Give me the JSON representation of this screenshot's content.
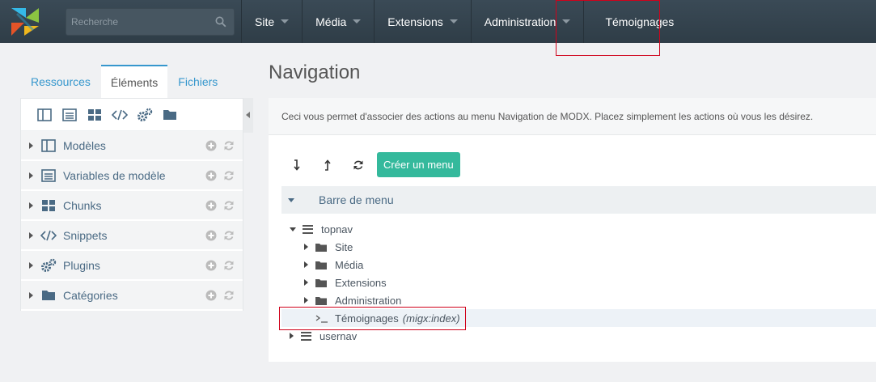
{
  "header": {
    "search_placeholder": "Recherche",
    "menu": [
      {
        "label": "Site"
      },
      {
        "label": "Média"
      },
      {
        "label": "Extensions"
      },
      {
        "label": "Administration"
      },
      {
        "label": "Témoignages"
      }
    ]
  },
  "sidebar": {
    "tabs": [
      {
        "label": "Ressources"
      },
      {
        "label": "Éléments",
        "active": true
      },
      {
        "label": "Fichiers"
      }
    ],
    "toolbar_icons": [
      "template-icon",
      "tv-icon",
      "chunk-icon",
      "snippet-icon",
      "plugin-icon",
      "folder-icon"
    ],
    "items": [
      {
        "label": "Modèles",
        "icon": "template-icon"
      },
      {
        "label": "Variables de modèle",
        "icon": "tv-icon"
      },
      {
        "label": "Chunks",
        "icon": "chunk-icon"
      },
      {
        "label": "Snippets",
        "icon": "snippet-icon"
      },
      {
        "label": "Plugins",
        "icon": "plugin-icon"
      },
      {
        "label": "Catégories",
        "icon": "folder-icon"
      }
    ]
  },
  "main": {
    "title": "Navigation",
    "description": "Ceci vous permet d'associer des actions au menu Navigation de MODX. Placez simplement les actions où vous les désirez.",
    "actions": {
      "create_label": "Créer un menu"
    },
    "tree": {
      "header_label": "Barre de menu",
      "topnav": "topnav",
      "children": [
        "Site",
        "Média",
        "Extensions",
        "Administration"
      ],
      "custom_item": "Témoignages",
      "custom_item_action": "(migx:index)",
      "usernav": "usernav"
    }
  },
  "colors": {
    "topbar": "#2f3d47",
    "accent": "#3697cd",
    "create_button": "#34b99c",
    "highlight": "#d0021b"
  }
}
